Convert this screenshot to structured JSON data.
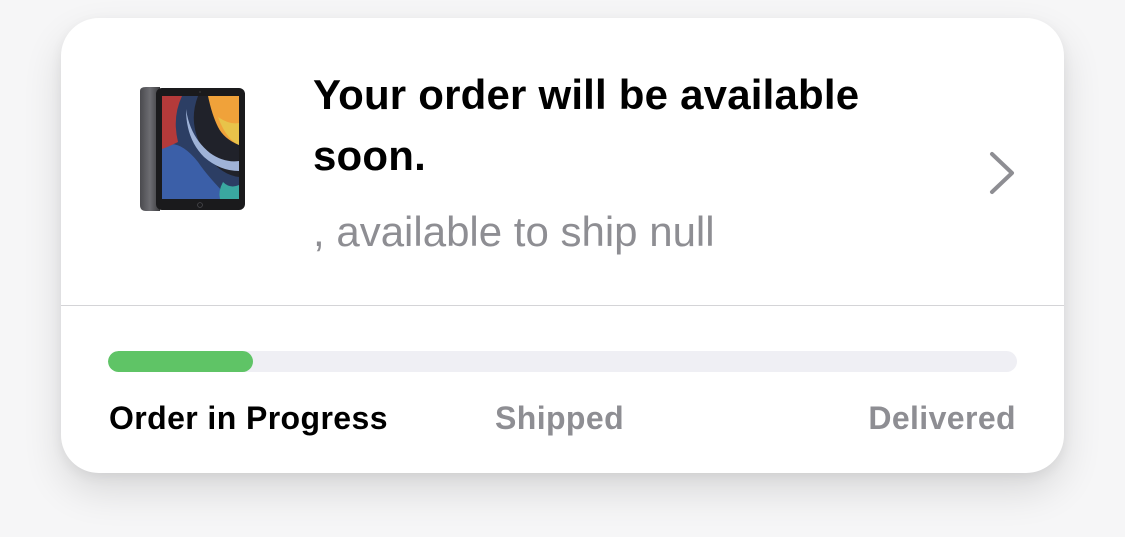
{
  "order": {
    "title": "Your order will be available soon.",
    "subtitle": ", available to ship null",
    "product_icon": "ipad-product-image",
    "chevron_icon": "chevron-right-icon"
  },
  "progress": {
    "fraction": 0.16,
    "fill_color": "#5fc466",
    "track_color": "#efeff4",
    "steps": [
      {
        "label": "Order in Progress",
        "active": true
      },
      {
        "label": "Shipped",
        "active": false
      },
      {
        "label": "Delivered",
        "active": false
      }
    ]
  },
  "colors": {
    "primary_text": "#000000",
    "secondary_text": "#8e8e93"
  }
}
